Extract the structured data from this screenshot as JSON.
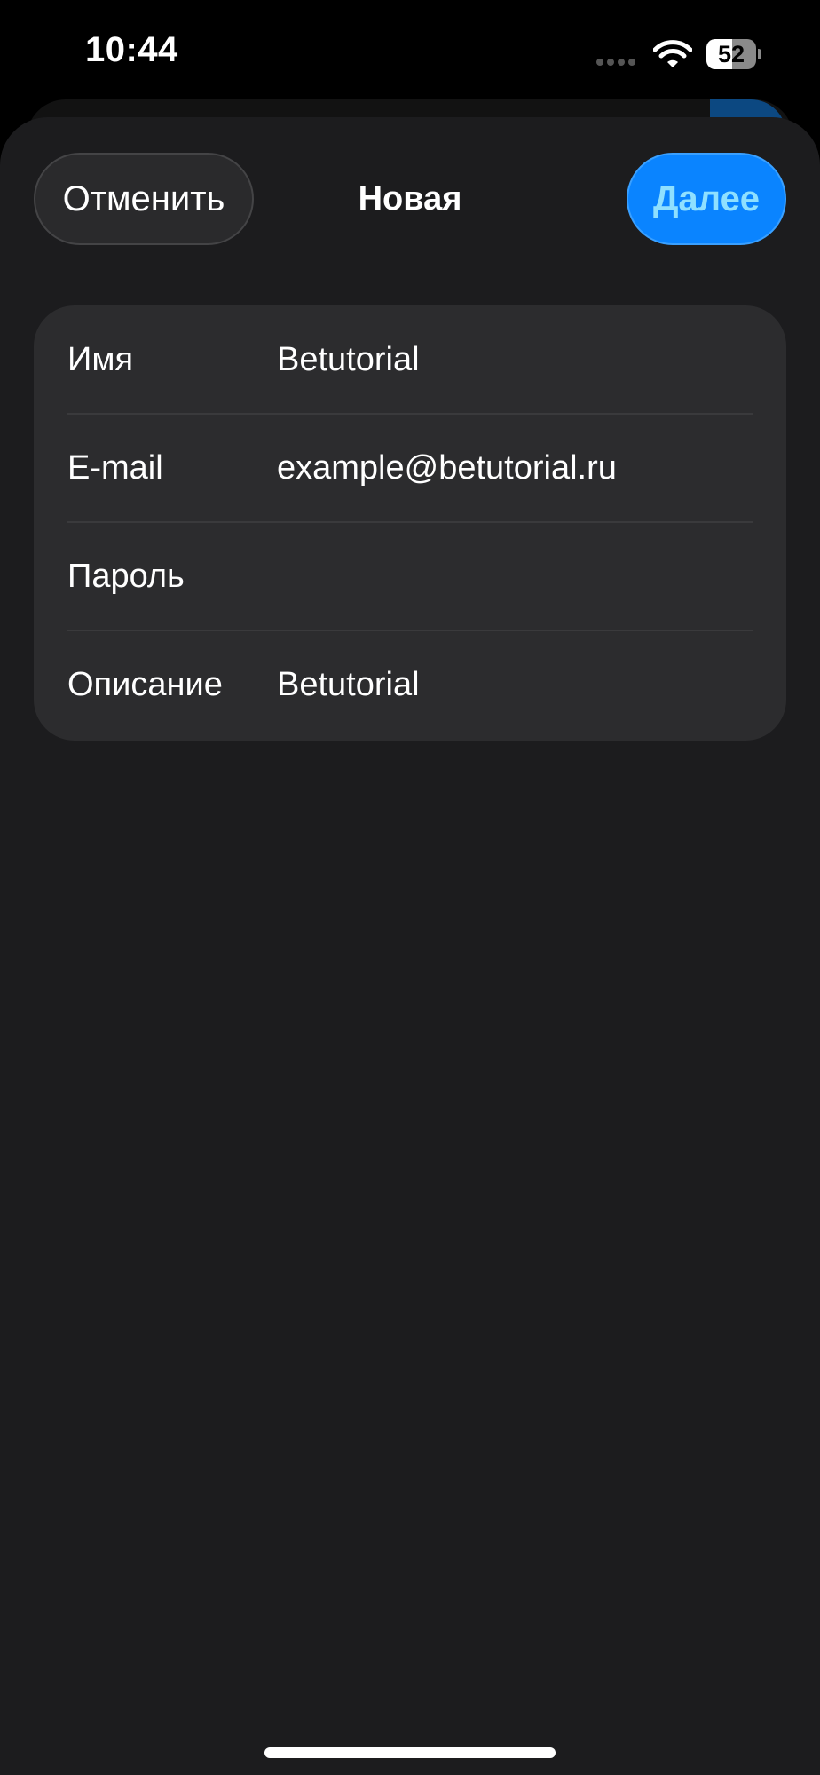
{
  "status_bar": {
    "time": "10:44",
    "battery_level": "52",
    "battery_fraction": 0.52,
    "icons": [
      "cellular-signal-icon",
      "wifi-icon",
      "battery-icon"
    ]
  },
  "header": {
    "cancel_label": "Отменить",
    "title": "Новая",
    "next_label": "Далее"
  },
  "form": {
    "rows": [
      {
        "label": "Имя",
        "value": "Betutorial"
      },
      {
        "label": "E-mail",
        "value": "example@betutorial.ru"
      },
      {
        "label": "Пароль",
        "value": ""
      },
      {
        "label": "Описание",
        "value": "Betutorial"
      }
    ]
  },
  "colors": {
    "accent": "#0a84ff",
    "sheet_background": "#1c1c1e",
    "card_background": "#2c2c2e"
  }
}
